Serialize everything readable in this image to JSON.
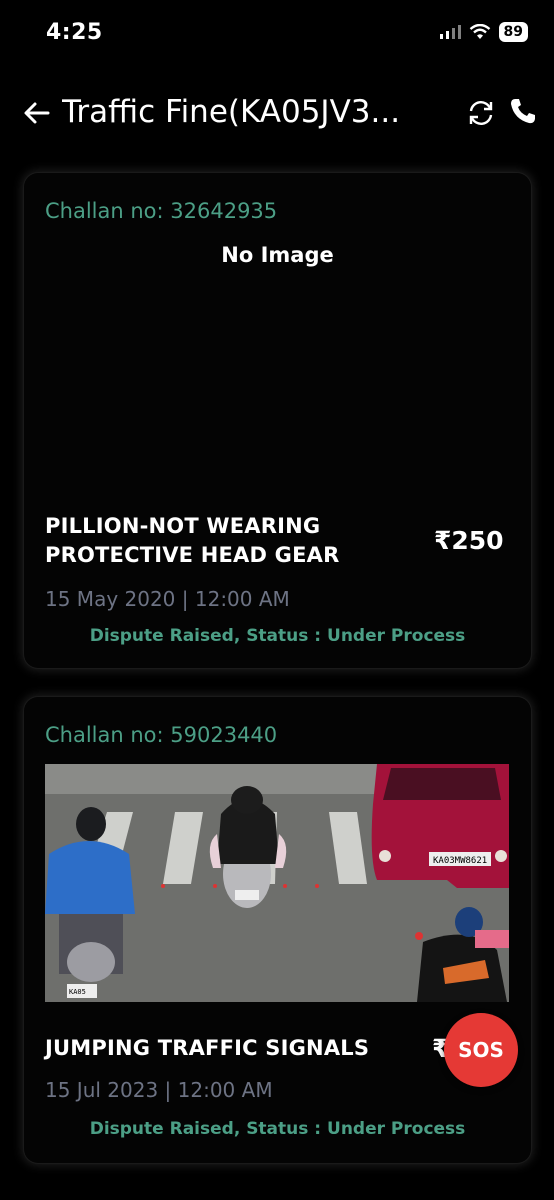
{
  "status_bar": {
    "time": "4:25",
    "battery": "89"
  },
  "header": {
    "title": "Traffic Fine(KA05JV3..."
  },
  "challans": [
    {
      "challan_no": "Challan no: 32642935",
      "image_text": "No Image",
      "offense_line1": "PILLION-NOT WEARING",
      "offense_line2": "PROTECTIVE HEAD GEAR",
      "amount": "₹250",
      "datetime": "15 May 2020 | 12:00 AM",
      "status": "Dispute Raised, Status : Under Process"
    },
    {
      "challan_no": "Challan no: 59023440",
      "photo_plates": [
        "KA03MW8621",
        "KA05",
        "KA 05"
      ],
      "offense_line1": "JUMPING TRAFFIC SIGNALS",
      "amount": "₹",
      "datetime": "15 Jul 2023 | 12:00 AM",
      "status": "Dispute Raised, Status : Under Process"
    }
  ],
  "sos": {
    "label": "SOS"
  },
  "colors": {
    "accent": "#4c9f86",
    "date": "#6d7384",
    "sos": "#e53935"
  }
}
